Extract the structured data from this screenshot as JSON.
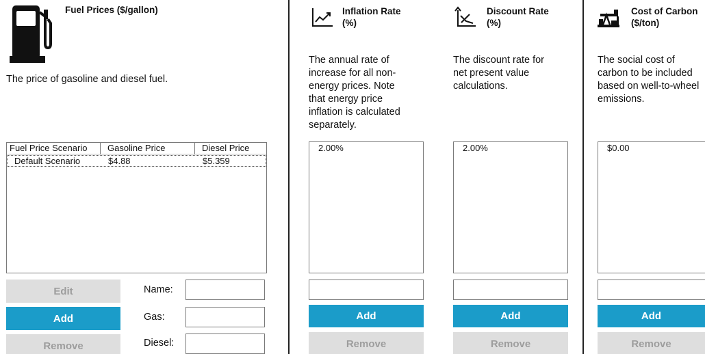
{
  "fuel": {
    "title": "Fuel Prices ($/gallon)",
    "description": "The price of gasoline and diesel fuel.",
    "icon": "fuel-pump-icon",
    "table": {
      "headers": [
        "Fuel Price Scenario",
        "Gasoline Price",
        "Diesel Price"
      ],
      "rows": [
        [
          "Default Scenario",
          "$4.88",
          "$5.359"
        ]
      ]
    },
    "buttons": {
      "edit": "Edit",
      "add": "Add",
      "remove": "Remove"
    },
    "fields": {
      "name_label": "Name:",
      "gas_label": "Gas:",
      "diesel_label": "Diesel:"
    }
  },
  "inflation": {
    "title_line1": "Inflation Rate",
    "title_line2": "(%)",
    "icon": "chart-trend-up-icon",
    "description_lines": [
      "The annual rate of",
      "increase for all non-",
      "energy prices. Note",
      "that energy price",
      "inflation is calculated",
      "separately."
    ],
    "values": [
      "2.00%"
    ],
    "buttons": {
      "add": "Add",
      "remove": "Remove"
    }
  },
  "discount": {
    "title_line1": "Discount Rate",
    "title_line2": "(%)",
    "icon": "chart-trend-down-icon",
    "description_lines": [
      "The discount rate for",
      "net present value",
      "calculations."
    ],
    "values": [
      "2.00%"
    ],
    "buttons": {
      "add": "Add",
      "remove": "Remove"
    }
  },
  "carbon": {
    "title_line1": "Cost of Carbon",
    "title_line2": "($/ton)",
    "icon": "oil-pump-icon",
    "description_lines": [
      "The social cost of",
      "carbon to be included",
      "based on well-to-wheel",
      "emissions."
    ],
    "values": [
      "$0.00"
    ],
    "buttons": {
      "add": "Add",
      "remove": "Remove"
    }
  },
  "colors": {
    "accent": "#1b9cc9",
    "disabled_bg": "#dedede",
    "disabled_text": "#9d9d9d",
    "divider": "#222222"
  }
}
